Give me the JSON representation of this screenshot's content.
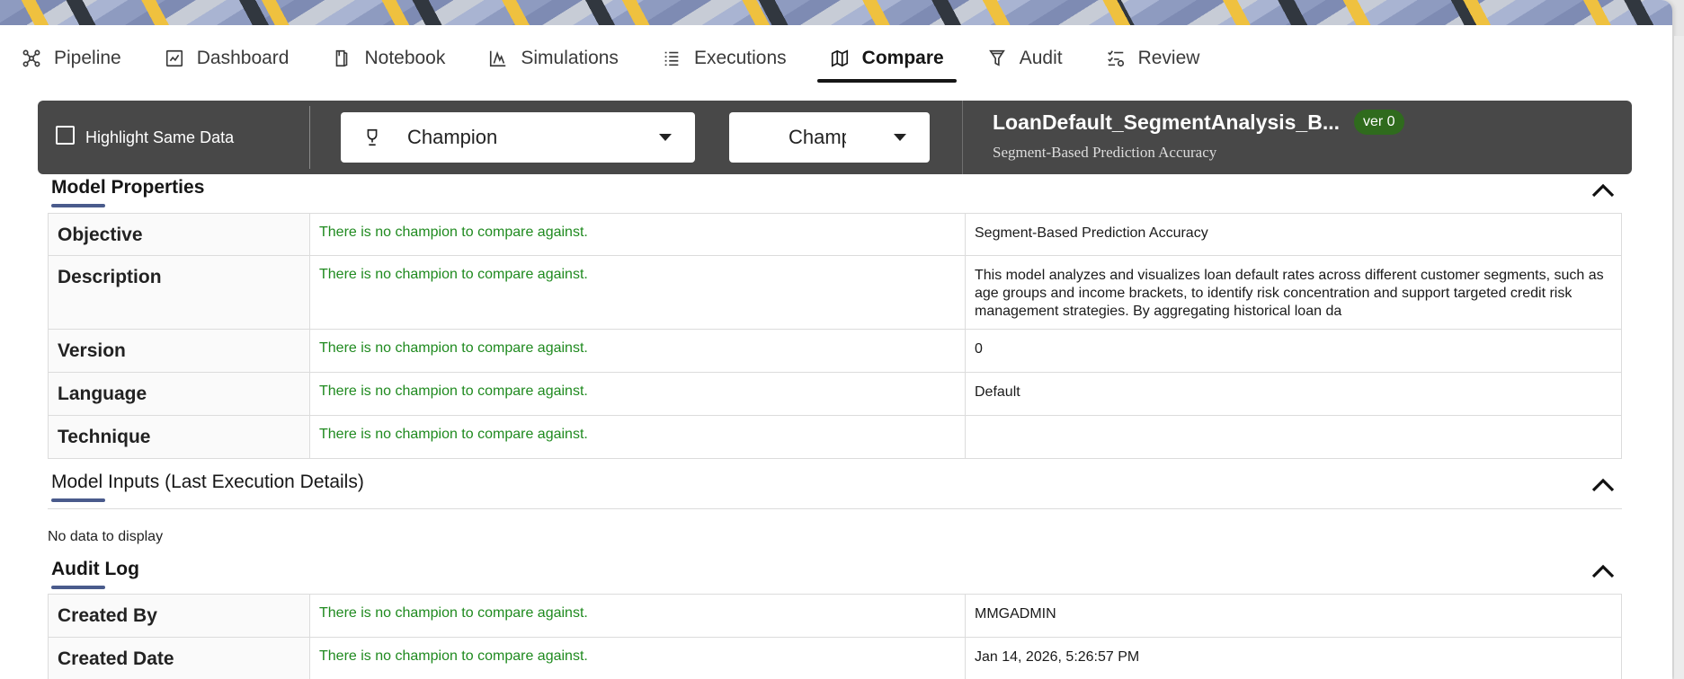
{
  "tabs": [
    {
      "label": "Pipeline",
      "icon": "pipeline-icon"
    },
    {
      "label": "Dashboard",
      "icon": "dashboard-icon"
    },
    {
      "label": "Notebook",
      "icon": "notebook-icon"
    },
    {
      "label": "Simulations",
      "icon": "simulations-icon"
    },
    {
      "label": "Executions",
      "icon": "executions-icon"
    },
    {
      "label": "Compare",
      "icon": "map-icon",
      "active": true
    },
    {
      "label": "Audit",
      "icon": "audit-icon"
    },
    {
      "label": "Review",
      "icon": "review-icon"
    }
  ],
  "compare_bar": {
    "highlight_label": "Highlight Same Data",
    "highlight_checked": false,
    "left_select": "Champion",
    "right_select": "Champion",
    "model_title": "LoanDefault_SegmentAnalysis_B...",
    "version_badge": "ver 0",
    "model_subtitle": "Segment-Based Prediction Accuracy"
  },
  "sections": {
    "model_properties": "Model Properties",
    "model_inputs": "Model Inputs (Last Execution Details)",
    "audit_log": "Audit Log"
  },
  "model_properties": [
    {
      "label": "Objective",
      "champion": "There is no champion to compare against.",
      "challenger": "Segment-Based Prediction Accuracy"
    },
    {
      "label": "Description",
      "champion": "There is no champion to compare against.",
      "challenger": "This model analyzes and visualizes loan default rates across different customer segments, such as age groups and income brackets, to identify risk concentration and support targeted credit risk management strategies. By aggregating historical loan da"
    },
    {
      "label": "Version",
      "champion": "There is no champion to compare against.",
      "challenger": "0"
    },
    {
      "label": "Language",
      "champion": "There is no champion to compare against.",
      "challenger": "Default"
    },
    {
      "label": "Technique",
      "champion": "There is no champion to compare against.",
      "challenger": ""
    }
  ],
  "model_inputs_empty": "No data to display",
  "audit_log": [
    {
      "label": "Created By",
      "champion": "There is no champion to compare against.",
      "challenger": "MMGADMIN"
    },
    {
      "label": "Created Date",
      "champion": "There is no champion to compare against.",
      "challenger": "Jan 14, 2026, 5:26:57 PM"
    }
  ],
  "colors": {
    "champion_text": "#1f8a1f",
    "bar_bg": "#484848",
    "badge_bg": "#2f6b1d",
    "underline_accent": "#4a5b8c"
  }
}
